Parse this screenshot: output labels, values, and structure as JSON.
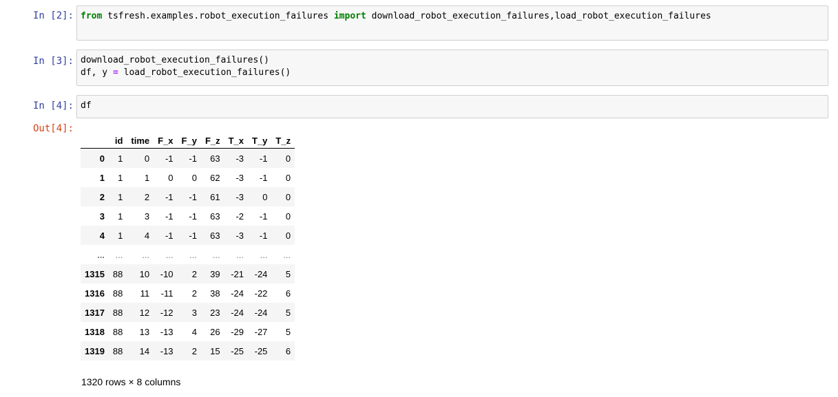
{
  "cells": [
    {
      "prompt": "In [2]:",
      "code_line1": {
        "kw1": "from",
        "module": " tsfresh.examples.robot_execution_failures ",
        "kw2": "import",
        "names": " download_robot_execution_failures,load_robot_execution_failures"
      }
    },
    {
      "prompt": "In [3]:",
      "line1": "download_robot_execution_failures()",
      "line2_a": "df, y ",
      "line2_op": "=",
      "line2_b": " load_robot_execution_failures()"
    },
    {
      "prompt": "In [4]:",
      "line1": "df"
    }
  ],
  "output": {
    "prompt": "Out[4]:",
    "columns": [
      "",
      "id",
      "time",
      "F_x",
      "F_y",
      "F_z",
      "T_x",
      "T_y",
      "T_z"
    ],
    "rows": [
      [
        "0",
        "1",
        "0",
        "-1",
        "-1",
        "63",
        "-3",
        "-1",
        "0"
      ],
      [
        "1",
        "1",
        "1",
        "0",
        "0",
        "62",
        "-3",
        "-1",
        "0"
      ],
      [
        "2",
        "1",
        "2",
        "-1",
        "-1",
        "61",
        "-3",
        "0",
        "0"
      ],
      [
        "3",
        "1",
        "3",
        "-1",
        "-1",
        "63",
        "-2",
        "-1",
        "0"
      ],
      [
        "4",
        "1",
        "4",
        "-1",
        "-1",
        "63",
        "-3",
        "-1",
        "0"
      ],
      [
        "...",
        "...",
        "...",
        "...",
        "...",
        "...",
        "...",
        "...",
        "..."
      ],
      [
        "1315",
        "88",
        "10",
        "-10",
        "2",
        "39",
        "-21",
        "-24",
        "5"
      ],
      [
        "1316",
        "88",
        "11",
        "-11",
        "2",
        "38",
        "-24",
        "-22",
        "6"
      ],
      [
        "1317",
        "88",
        "12",
        "-12",
        "3",
        "23",
        "-24",
        "-24",
        "5"
      ],
      [
        "1318",
        "88",
        "13",
        "-13",
        "4",
        "26",
        "-29",
        "-27",
        "5"
      ],
      [
        "1319",
        "88",
        "14",
        "-13",
        "2",
        "15",
        "-25",
        "-25",
        "6"
      ]
    ],
    "shape_text": "1320 rows × 8 columns"
  }
}
